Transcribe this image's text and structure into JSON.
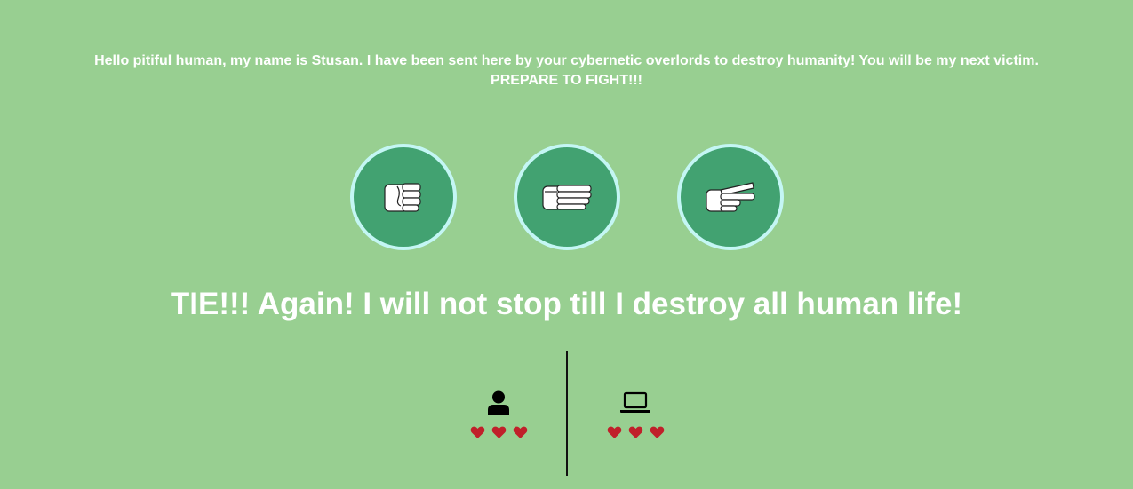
{
  "intro": {
    "line1": "Hello pitiful human, my name is Stusan. I have been sent here by your cybernetic overlords to destroy humanity! You will be my next victim.",
    "line2": "PREPARE TO FIGHT!!!"
  },
  "choices": [
    {
      "name": "rock",
      "icon": "rock-fist-icon"
    },
    {
      "name": "paper",
      "icon": "paper-hand-icon"
    },
    {
      "name": "scissors",
      "icon": "scissors-hand-icon"
    }
  ],
  "result_text": "TIE!!! Again! I will not stop till I destroy all human life!",
  "scoreboard": {
    "human": {
      "icon": "user-icon",
      "lives": 3
    },
    "computer": {
      "icon": "laptop-icon",
      "lives": 3
    }
  },
  "colors": {
    "background": "#98cf91",
    "button_fill": "#42a271",
    "button_border": "#c4f6f4",
    "heart": "#c0202a"
  }
}
